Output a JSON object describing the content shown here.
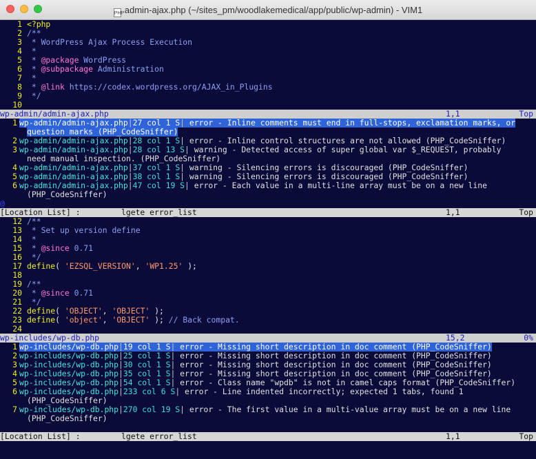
{
  "window": {
    "title": "admin-ajax.php (~/sites_pm/woodlakemedical/app/public/wp-admin) - VIM1",
    "file_icon_label": "PHP"
  },
  "pane1": {
    "lines": [
      {
        "n": "1",
        "parts": [
          {
            "t": "<?php",
            "c": "php"
          }
        ]
      },
      {
        "n": "2",
        "parts": [
          {
            "t": "/**",
            "c": "cmt"
          }
        ]
      },
      {
        "n": "3",
        "parts": [
          {
            "t": " * WordPress Ajax Process Execution",
            "c": "cmt"
          }
        ]
      },
      {
        "n": "4",
        "parts": [
          {
            "t": " *",
            "c": "cmt"
          }
        ]
      },
      {
        "n": "5",
        "parts": [
          {
            "t": " * ",
            "c": "cmt"
          },
          {
            "t": "@package",
            "c": "kw"
          },
          {
            "t": " WordPress",
            "c": "cmt"
          }
        ]
      },
      {
        "n": "6",
        "parts": [
          {
            "t": " * ",
            "c": "cmt"
          },
          {
            "t": "@subpackage",
            "c": "kw"
          },
          {
            "t": " Administration",
            "c": "cmt"
          }
        ]
      },
      {
        "n": "7",
        "parts": [
          {
            "t": " *",
            "c": "cmt"
          }
        ]
      },
      {
        "n": "8",
        "parts": [
          {
            "t": " * ",
            "c": "cmt"
          },
          {
            "t": "@link",
            "c": "kw"
          },
          {
            "t": " https://codex.wordpress.org/AJAX_in_Plugins",
            "c": "cmt"
          }
        ]
      },
      {
        "n": "9",
        "parts": [
          {
            "t": " */",
            "c": "cmt"
          }
        ]
      },
      {
        "n": "10",
        "parts": []
      }
    ],
    "status": {
      "name": "wp-admin/admin-ajax.php",
      "pos": "1,1",
      "pct": "Top"
    }
  },
  "qf1": {
    "items": [
      {
        "n": "1",
        "file": "wp-admin/admin-ajax.php",
        "loc": "27 col 1 S",
        "msg": " error - Inline comments must end in full-stops, exclamation marks, or",
        "cont": "question marks (PHP_CodeSniffer)",
        "selected": true
      },
      {
        "n": "2",
        "file": "wp-admin/admin-ajax.php",
        "loc": "28 col 1 S",
        "msg": " error - Inline control structures are not allowed (PHP_CodeSniffer)"
      },
      {
        "n": "3",
        "file": "wp-admin/admin-ajax.php",
        "loc": "28 col 13 S",
        "msg": " warning - Detected access of super global var $_REQUEST, probably",
        "cont": "need manual inspection. (PHP_CodeSniffer)"
      },
      {
        "n": "4",
        "file": "wp-admin/admin-ajax.php",
        "loc": "37 col 1 S",
        "msg": " warning - Silencing errors is discouraged (PHP_CodeSniffer)"
      },
      {
        "n": "5",
        "file": "wp-admin/admin-ajax.php",
        "loc": "38 col 1 S",
        "msg": " warning - Silencing errors is discouraged (PHP_CodeSniffer)"
      },
      {
        "n": "6",
        "file": "wp-admin/admin-ajax.php",
        "loc": "47 col 19 S",
        "msg": " error - Each value in a multi-line array must be on a new line",
        "cont": "(PHP_CodeSniffer)"
      }
    ],
    "tilde": "@",
    "status": {
      "name": "[Location List] :",
      "cmd": "lgete error_list",
      "pos": "1,1",
      "pct": "Top"
    }
  },
  "pane2": {
    "lines": [
      {
        "n": "12",
        "parts": [
          {
            "t": "/**",
            "c": "cmt"
          }
        ]
      },
      {
        "n": "13",
        "parts": [
          {
            "t": " * Set up version define",
            "c": "cmt"
          }
        ]
      },
      {
        "n": "14",
        "parts": [
          {
            "t": " *",
            "c": "cmt"
          }
        ]
      },
      {
        "n": "15",
        "parts": [
          {
            "t": " * ",
            "c": "cmt"
          },
          {
            "t": "@since",
            "c": "kw"
          },
          {
            "t": " 0.71",
            "c": "cmt"
          }
        ]
      },
      {
        "n": "16",
        "parts": [
          {
            "t": " */",
            "c": "cmt"
          }
        ]
      },
      {
        "n": "17",
        "parts": [
          {
            "t": "define",
            "c": "php"
          },
          {
            "t": "( ",
            "c": "fn"
          },
          {
            "t": "'EZSQL_VERSION'",
            "c": "str"
          },
          {
            "t": ", ",
            "c": "fn"
          },
          {
            "t": "'WP1.25'",
            "c": "str"
          },
          {
            "t": " );",
            "c": "fn"
          }
        ]
      },
      {
        "n": "18",
        "parts": []
      },
      {
        "n": "19",
        "parts": [
          {
            "t": "/**",
            "c": "cmt"
          }
        ]
      },
      {
        "n": "20",
        "parts": [
          {
            "t": " * ",
            "c": "cmt"
          },
          {
            "t": "@since",
            "c": "kw"
          },
          {
            "t": " 0.71",
            "c": "cmt"
          }
        ]
      },
      {
        "n": "21",
        "parts": [
          {
            "t": " */",
            "c": "cmt"
          }
        ]
      },
      {
        "n": "22",
        "parts": [
          {
            "t": "define",
            "c": "php"
          },
          {
            "t": "( ",
            "c": "fn"
          },
          {
            "t": "'OBJECT'",
            "c": "str"
          },
          {
            "t": ", ",
            "c": "fn"
          },
          {
            "t": "'OBJECT'",
            "c": "str"
          },
          {
            "t": " );",
            "c": "fn"
          }
        ]
      },
      {
        "n": "23",
        "parts": [
          {
            "t": "define",
            "c": "php"
          },
          {
            "t": "( ",
            "c": "fn"
          },
          {
            "t": "'object'",
            "c": "str"
          },
          {
            "t": ", ",
            "c": "fn"
          },
          {
            "t": "'OBJECT'",
            "c": "str"
          },
          {
            "t": " ); ",
            "c": "fn"
          },
          {
            "t": "// Back compat.",
            "c": "cmt"
          }
        ]
      },
      {
        "n": "24",
        "parts": []
      }
    ],
    "status": {
      "name": "wp-includes/wp-db.php",
      "pos": "15,2",
      "pct": "0%"
    }
  },
  "qf2": {
    "items": [
      {
        "n": "1",
        "file": "wp-includes/wp-db.php",
        "loc": "19 col 1 S",
        "msg": " error - Missing short description in doc comment (PHP_CodeSniffer)",
        "selected": true
      },
      {
        "n": "2",
        "file": "wp-includes/wp-db.php",
        "loc": "25 col 1 S",
        "msg": " error - Missing short description in doc comment (PHP_CodeSniffer)"
      },
      {
        "n": "3",
        "file": "wp-includes/wp-db.php",
        "loc": "30 col 1 S",
        "msg": " error - Missing short description in doc comment (PHP_CodeSniffer)"
      },
      {
        "n": "4",
        "file": "wp-includes/wp-db.php",
        "loc": "35 col 1 S",
        "msg": " error - Missing short description in doc comment (PHP_CodeSniffer)"
      },
      {
        "n": "5",
        "file": "wp-includes/wp-db.php",
        "loc": "54 col 1 S",
        "msg": " error - Class name \"wpdb\" is not in camel caps format (PHP_CodeSniffer)"
      },
      {
        "n": "6",
        "file": "wp-includes/wp-db.php",
        "loc": "233 col 6 S",
        "msg": " error - Line indented incorrectly; expected 1 tabs, found 1",
        "cont": "(PHP_CodeSniffer)"
      },
      {
        "n": "7",
        "file": "wp-includes/wp-db.php",
        "loc": "270 col 19 S",
        "msg": " error - The first value in a multi-value array must be on a new line",
        "cont": "(PHP_CodeSniffer)"
      }
    ],
    "status": {
      "name": "[Location List] :",
      "cmd": "lgete error_list",
      "pos": "1,1",
      "pct": "Top"
    }
  },
  "colors": {
    "background": "#0b0b3a",
    "selection": "#2f63d8",
    "line_numbers": "#f0f020"
  }
}
